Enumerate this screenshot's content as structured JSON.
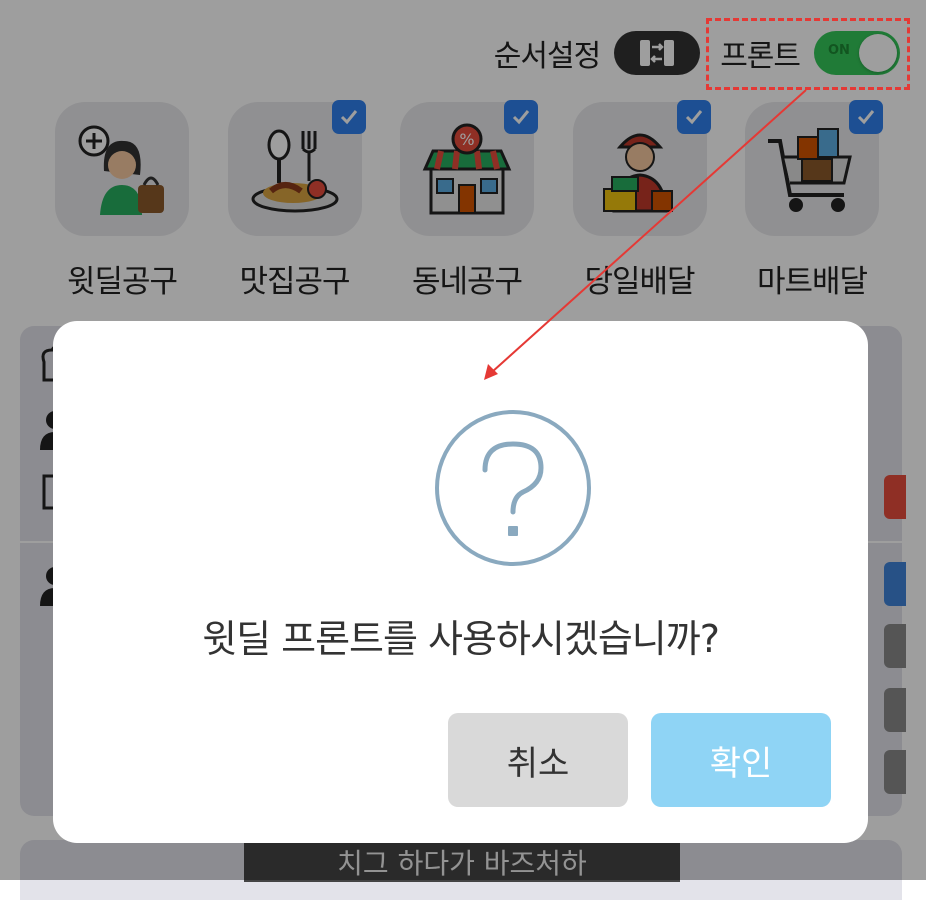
{
  "topbar": {
    "order_label": "순서설정",
    "front_label": "프론트",
    "front_toggle_text": "ON"
  },
  "categories": [
    {
      "label": "윗딜공구",
      "icon": "add-shopping-girl-icon",
      "checked": false
    },
    {
      "label": "맛집공구",
      "icon": "restaurant-food-icon",
      "checked": true
    },
    {
      "label": "동네공구",
      "icon": "local-store-icon",
      "checked": true
    },
    {
      "label": "당일배달",
      "icon": "delivery-man-icon",
      "checked": true
    },
    {
      "label": "마트배달",
      "icon": "mart-cart-icon",
      "checked": true
    }
  ],
  "background": {
    "banner_text": "치그 하다가 바즈처하"
  },
  "dialog": {
    "icon": "question-icon",
    "message": "윗딜 프론트를 사용하시겠습니까?",
    "cancel_label": "취소",
    "confirm_label": "확인"
  },
  "colors": {
    "toggle_on": "#34c759",
    "check_blue": "#2f80ed",
    "confirm_button": "#8fd4f5",
    "cancel_button": "#d9d9d9",
    "question_icon": "#8aa9bf",
    "highlight": "#e53935"
  }
}
